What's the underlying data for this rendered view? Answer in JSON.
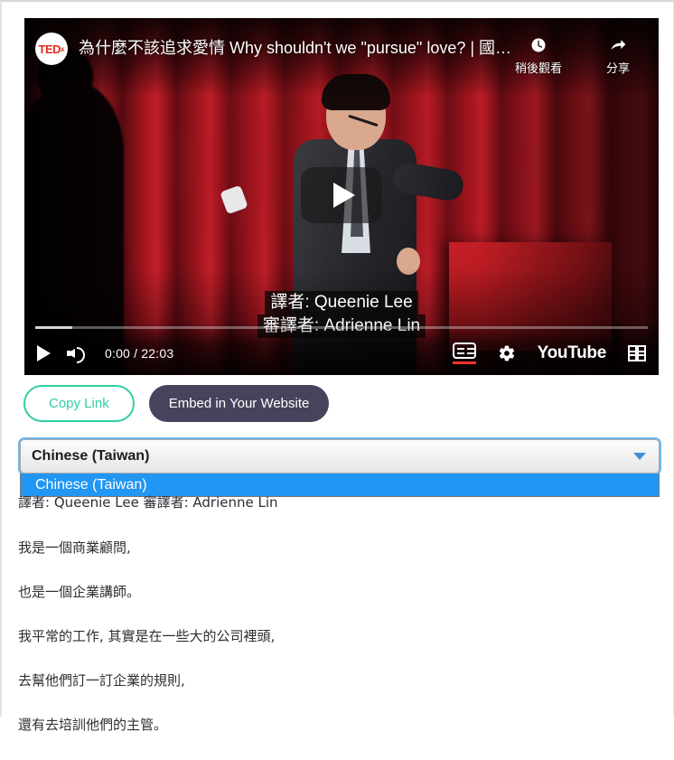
{
  "video": {
    "title": "為什麼不該追求愛情 Why shouldn't we \"pursue\" love? | 國…",
    "channel_avatar_text": "TED",
    "channel_avatar_superscript": "x",
    "actions": [
      {
        "icon": "clock-icon",
        "glyph": "🕐",
        "label": "稍後觀看"
      },
      {
        "icon": "share-arrow-icon",
        "glyph": "➦",
        "label": "分享"
      }
    ],
    "captions": [
      "譯者: Queenie Lee",
      "審譯者: Adrienne Lin"
    ],
    "controls": {
      "play_label": "play-button",
      "volume_label": "volume-button",
      "time": "0:00 / 22:03",
      "current_time": "0:00",
      "duration": "22:03",
      "subtitles_label": "subtitles-button",
      "settings_label": "settings-button",
      "youtube_wordmark": "YouTube",
      "fullscreen_label": "fullscreen-button",
      "progress_percent": 0
    }
  },
  "buttons": {
    "copy_link": "Copy Link",
    "embed": "Embed in Your Website"
  },
  "language_select": {
    "selected": "Chinese (Taiwan)",
    "expanded": true,
    "options": [
      "Chinese (Taiwan)"
    ]
  },
  "transcript": {
    "paragraphs": [
      "譯者: Queenie Lee 審譯者: Adrienne Lin",
      "我是一個商業顧問,",
      "也是一個企業講師。",
      "我平常的工作, 其實是在一些大的公司裡頭,",
      "去幫他們訂一訂企業的規則,",
      "還有去培訓他們的主管。"
    ]
  },
  "colors": {
    "copy_link_accent": "#2ecfa3",
    "embed_bg": "#45445c",
    "select_highlight": "#2196f3",
    "focus_ring": "#56aaeb",
    "cc_active": "#f0342a",
    "ted_red": "#e62b1e"
  }
}
